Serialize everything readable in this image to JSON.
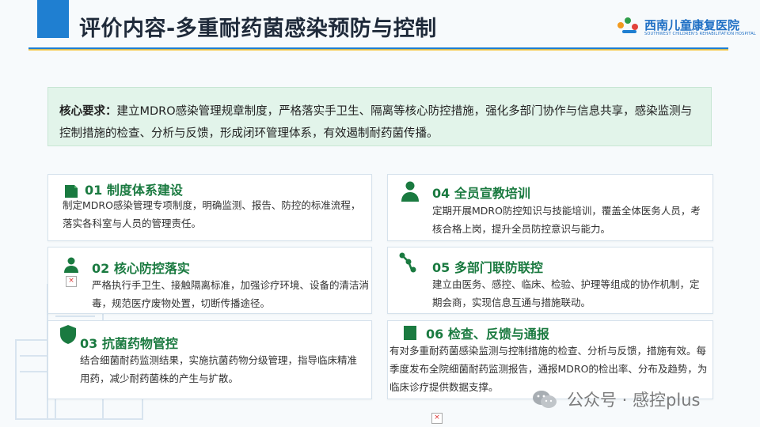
{
  "header": {
    "title": "评价内容-多重耐药菌感染预防与控制",
    "logo_name": "西南儿童康复医院",
    "logo_sub": "SOUTHWEST CHILDREN'S REHABILITATION HOSPITAL"
  },
  "core": {
    "label": "核心要求：",
    "text": "建立MDRO感染管理规章制度，严格落实手卫生、隔离等核心防控措施，强化多部门协作与信息共享，感染监测与控制措施的检查、分析与反馈，形成闭环管理体系，有效遏制耐药菌传播。"
  },
  "cards": [
    {
      "title": "01 制度体系建设",
      "text": "制定MDRO感染管理专项制度，明确监测、报告、防控的标准流程，落实各科室与人员的管理责任。",
      "icon": "document-icon"
    },
    {
      "title": "02 核心防控落实",
      "text": "严格执行手卫生、接触隔离标准，加强诊疗环境、设备的清洁消毒，规范医疗废物处置，切断传播途径。",
      "icon": "person-icon"
    },
    {
      "title": "03 抗菌药物管控",
      "text": "结合细菌耐药监测结果，实施抗菌药物分级管理，指导临床精准用药，减少耐药菌株的产生与扩散。",
      "icon": "shield-icon"
    },
    {
      "title": "04 全员宣教培训",
      "text": "定期开展MDRO防控知识与技能培训，覆盖全体医务人员，考核合格上岗，提升全员防控意识与能力。",
      "icon": "person-icon"
    },
    {
      "title": "05 多部门联防联控",
      "text": "建立由医务、感控、临床、检验、护理等组成的协作机制，定期会商，实现信息互通与措施联动。",
      "icon": "network-icon"
    },
    {
      "title": "06 检查、反馈与通报",
      "text": "有对多重耐药菌感染监测与控制措施的检查、分析与反馈，措施有效。每季度发布全院细菌耐药监测报告，通报MDRO的检出率、分布及趋势，为临床诊疗提供数据支撑。",
      "icon": "document-icon"
    }
  ],
  "watermark": {
    "text": "公众号 · 感控plus"
  },
  "colors": {
    "accent_blue": "#1f7fd1",
    "accent_green": "#1a7a40",
    "core_bg": "#e2f4ea"
  }
}
